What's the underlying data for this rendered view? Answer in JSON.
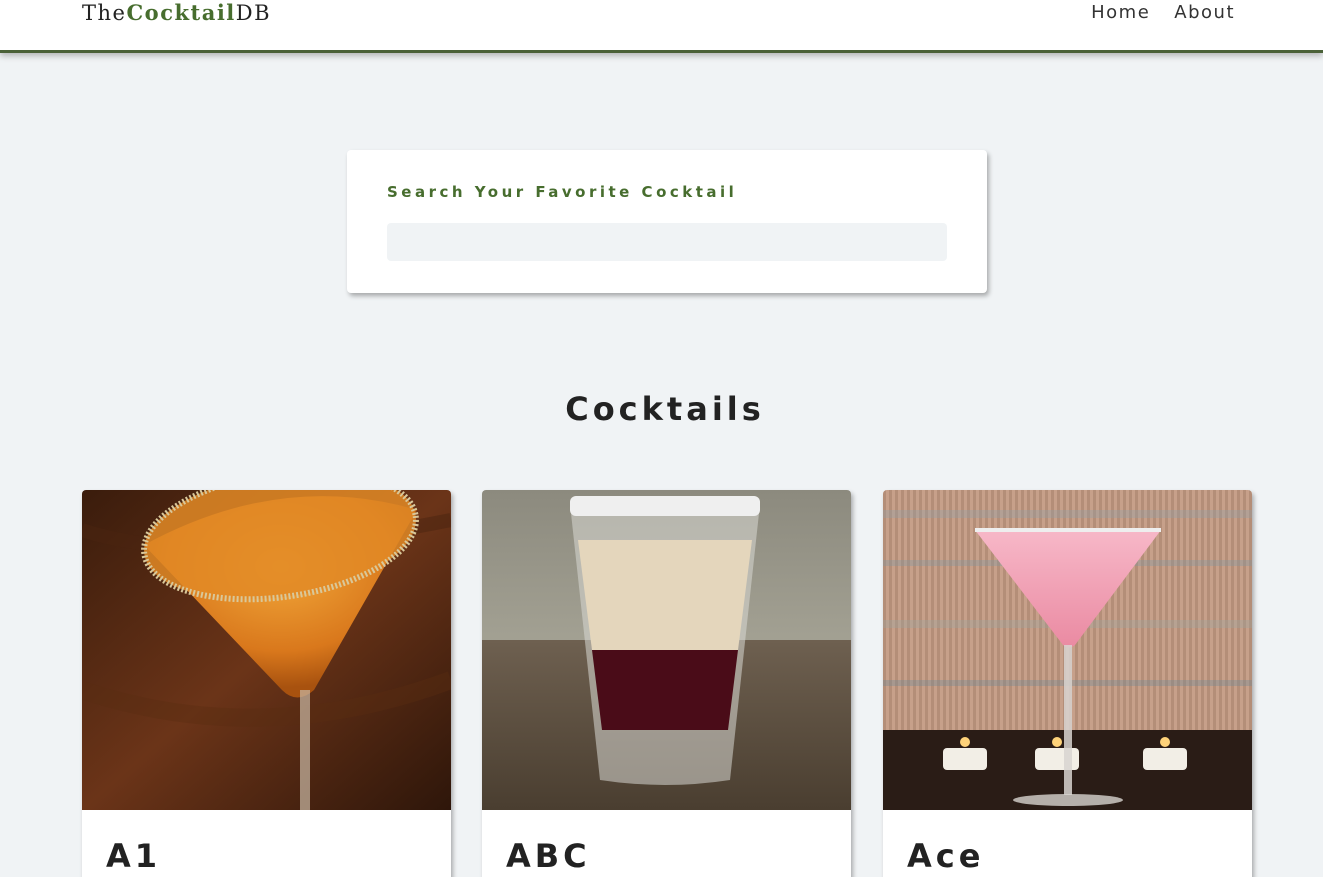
{
  "header": {
    "logo_prefix": "The",
    "logo_accent": "Cocktail",
    "logo_suffix": "DB",
    "nav": [
      "Home",
      "About"
    ]
  },
  "search": {
    "label": "Search Your Favorite Cocktail",
    "value": ""
  },
  "section_title": "Cocktails",
  "cocktails": [
    {
      "name": "A1"
    },
    {
      "name": "ABC"
    },
    {
      "name": "Ace"
    }
  ],
  "colors": {
    "accent": "#476d2e",
    "background": "#f0f3f5"
  }
}
